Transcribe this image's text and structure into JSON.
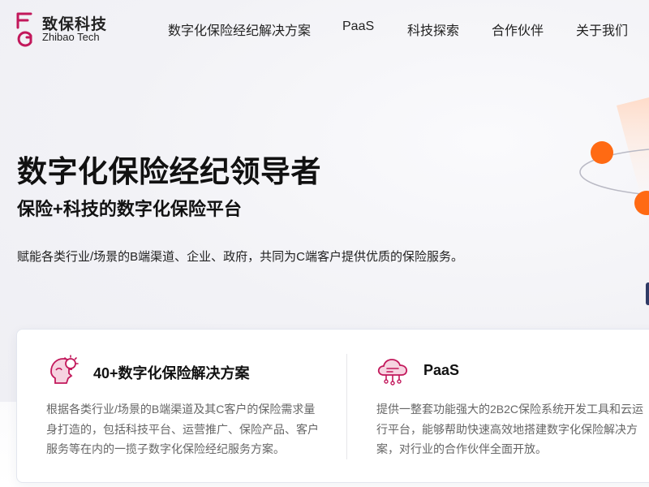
{
  "logo": {
    "name_cn": "致保科技",
    "name_en": "Zhibao Tech"
  },
  "nav": {
    "items": [
      {
        "label": "数字化保险经纪解决方案"
      },
      {
        "label": "PaaS"
      },
      {
        "label": "科技探索"
      },
      {
        "label": "合作伙伴"
      },
      {
        "label": "关于我们"
      }
    ]
  },
  "hero": {
    "title": "数字化保险经纪领导者",
    "subtitle": "保险+科技的数字化保险平台",
    "description": "赋能各类行业/场景的B端渠道、企业、政府，共同为C端客户提供优质的保险服务。"
  },
  "cards": [
    {
      "title": "40+数字化保险解决方案",
      "icon": "head-lightbulb-icon",
      "body": "根据各类行业/场景的B端渠道及其C客户的保险需求量身打造的，包括科技平台、运营推广、保险产品、客户服务等在内的一揽子数字化保险经纪服务方案。"
    },
    {
      "title": "PaaS",
      "icon": "cloud-circuit-icon",
      "body": "提供一整套功能强大的2B2C保险系统开发工具和云运行平台，能够帮助快速高效地搭建数字化保险解决方案，对行业的合作伙伴全面开放。"
    }
  ],
  "colors": {
    "brand": "#c2185b",
    "accent_orange": "#ff6a13",
    "text_dark": "#111111",
    "text_muted": "#666666"
  }
}
